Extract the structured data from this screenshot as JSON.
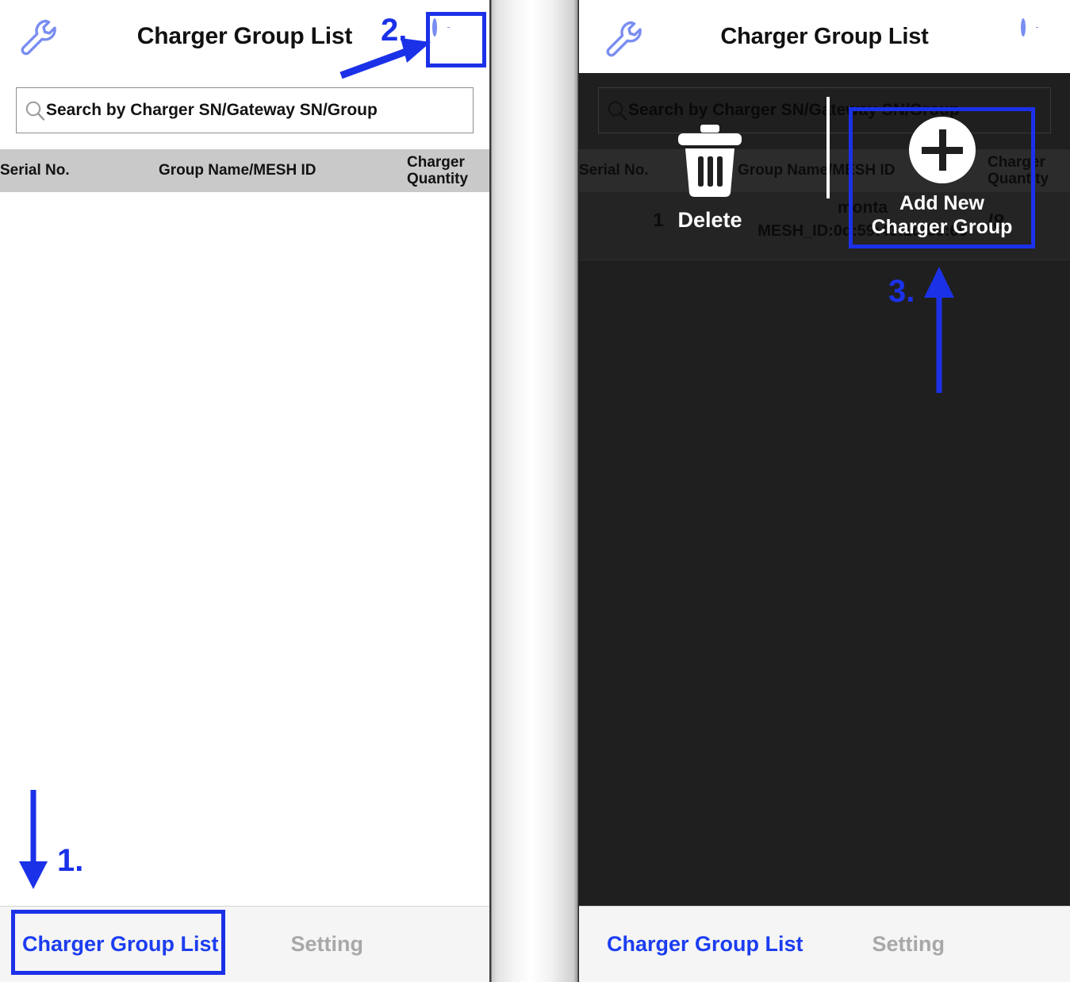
{
  "meta": {
    "app_screen_title": "Charger Group List"
  },
  "left_panel": {
    "header": {
      "title": "Charger Group List",
      "wrench_icon": "wrench-icon",
      "add_icon": "plus-circle-icon"
    },
    "search": {
      "placeholder": "Search by Charger SN/Gateway SN/Group",
      "icon": "search-icon",
      "value": ""
    },
    "table": {
      "columns": [
        "Serial No.",
        "Group Name/MESH ID",
        "Charger Quantity"
      ],
      "column_serial": "Serial No.",
      "column_group": "Group Name/MESH ID",
      "column_qty_line1": "Charger",
      "column_qty_line2": "Quantity",
      "rows": []
    },
    "tabbar": {
      "active_label": "Charger Group List",
      "inactive_label": "Setting"
    }
  },
  "right_panel": {
    "header": {
      "title": "Charger Group List",
      "wrench_icon": "wrench-icon",
      "add_icon": "plus-circle-icon"
    },
    "search": {
      "placeholder": "Search by Charger SN/Gateway SN/Group",
      "icon": "search-icon",
      "value": ""
    },
    "table": {
      "column_serial": "Serial No.",
      "column_group": "Group Name/MESH ID",
      "column_qty_line1": "Charger",
      "column_qty_line2": "Quantity",
      "rows": [
        {
          "serial": "1",
          "group_name": "monta",
          "mesh_id": "MESH_ID:0d:59:43:1d:59:60",
          "charger_quantity": "/8"
        }
      ]
    },
    "action_sheet": {
      "delete_label": "Delete",
      "delete_icon": "trash-icon",
      "add_label_line1": "Add New",
      "add_label_line2": "Charger Group",
      "add_icon": "plus-circle-filled-icon"
    },
    "tabbar": {
      "active_label": "Charger Group List",
      "inactive_label": "Setting"
    }
  },
  "annotations": {
    "step1": "1.",
    "step2": "2.",
    "step3": "3.",
    "color": "#1b31e8"
  },
  "colors": {
    "accent_blue": "#1c3df0",
    "annotation_blue": "#1b31e8",
    "icon_periwinkle": "#7a8df0",
    "table_header_gray": "#c9c9c9",
    "inactive_tab_gray": "#a8a8a8",
    "overlay_dark": "#1f1f1f"
  }
}
